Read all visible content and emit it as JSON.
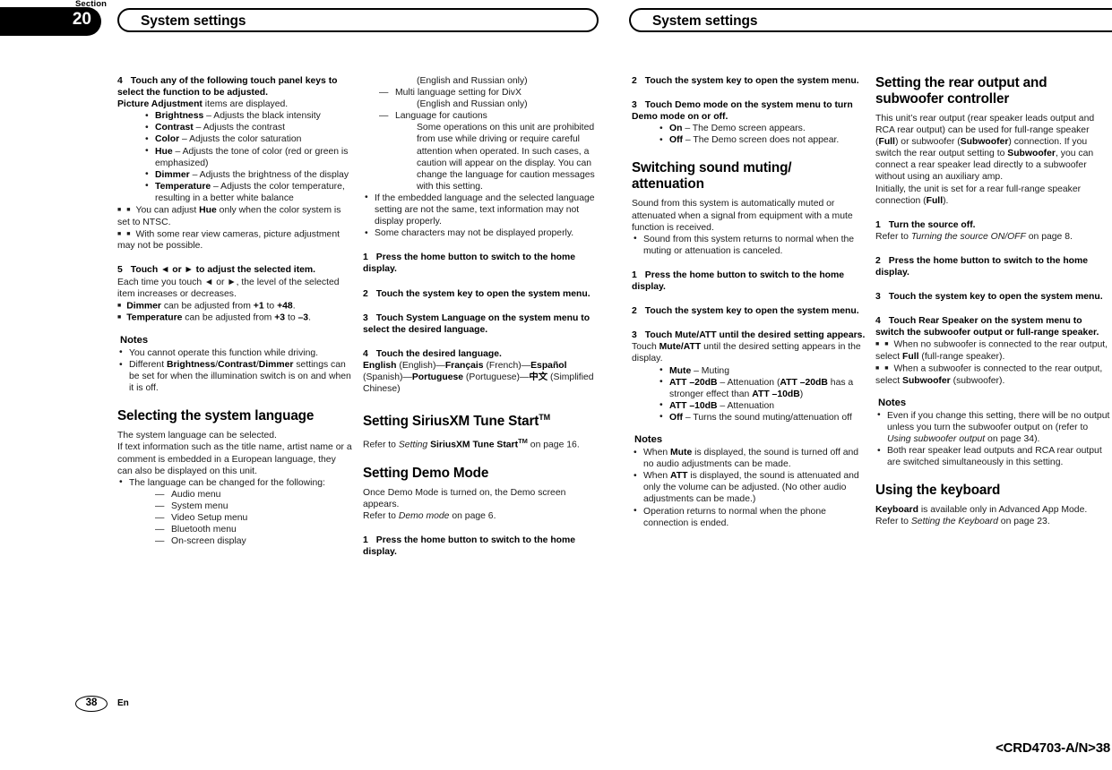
{
  "header": {
    "section_word": "Section",
    "section_number": "20",
    "title_left": "System settings",
    "title_right": "System settings"
  },
  "footer": {
    "page_number": "38",
    "language_code": "En",
    "doc_reference": "<CRD4703-A/N>38"
  },
  "col1": {
    "step4": {
      "number": "4",
      "text": "Touch any of the following touch panel keys to select the function to be adjusted."
    },
    "step4_intro_bold": "Picture Adjustment",
    "step4_intro_rest": " items are displayed.",
    "adjust_items": [
      {
        "term": "Brightness",
        "desc": " – Adjusts the black intensity"
      },
      {
        "term": "Contrast",
        "desc": " – Adjusts the contrast"
      },
      {
        "term": "Color",
        "desc": " – Adjusts the color saturation"
      },
      {
        "term": "Hue",
        "desc": " – Adjusts the tone of color (red or green is emphasized)"
      },
      {
        "term": "Dimmer",
        "desc": " – Adjusts the brightness of the display"
      },
      {
        "term": "Temperature",
        "desc": " – Adjusts the color temperature, resulting in a better white balance"
      }
    ],
    "note_hue_a": "You can adjust ",
    "note_hue_b": "Hue",
    "note_hue_c": " only when the color system is set to NTSC.",
    "note_camera": "With some rear view cameras, picture adjustment may not be possible.",
    "step5": {
      "number": "5",
      "text": "Touch ◄ or ► to adjust the selected item."
    },
    "step5_body": "Each time you touch ◄ or ►, the level of the selected item increases or decreases.",
    "range_dimmer": {
      "term": "Dimmer",
      "mid": " can be adjusted from ",
      "from": "+1",
      "to_word": " to ",
      "to": "+48",
      "end": "."
    },
    "range_temp": {
      "term": "Temperature",
      "mid": " can be adjusted from ",
      "from": "+3",
      "to_word": " to ",
      "to": "–3",
      "end": "."
    },
    "notes_label": "Notes",
    "note_driving": "You cannot operate this function while driving.",
    "note_diff_a": "Different ",
    "note_diff_b": "Brightness",
    "note_diff_c": "/",
    "note_diff_d": "Contrast",
    "note_diff_e": "/",
    "note_diff_f": "Dimmer",
    "note_diff_g": " settings can be set for when the illumination switch is on and when it is off.",
    "heading_language": "Selecting the system language",
    "lang_p1": "The system language can be selected.",
    "lang_p2": "If text information such as the title name, artist name or a comment is embedded in a European language, they can also be displayed on this unit.",
    "lang_bullet": "The language can be changed for the following:",
    "lang_menus": [
      "Audio menu",
      "System menu",
      "Video Setup menu",
      "Bluetooth menu",
      "On-screen display"
    ]
  },
  "col2": {
    "cont_note_1": "(English and Russian only)",
    "dash_divx": "Multi language setting for DivX",
    "cont_note_2": "(English and Russian only)",
    "dash_cautions": "Language for cautions",
    "cautions_body": "Some operations on this unit are prohibited from use while driving or require careful attention when operated. In such cases, a caution will appear on the display. You can change the language for caution messages with this setting.",
    "bullet_embedded": "If the embedded language and the selected language setting are not the same, text information may not display properly.",
    "bullet_chars": "Some characters may not be displayed properly.",
    "step1": {
      "number": "1",
      "text": "Press the home button to switch to the home display."
    },
    "step2": {
      "number": "2",
      "text": "Touch the system key to open the system menu."
    },
    "step3": {
      "number": "3",
      "text": "Touch System Language on the system menu to select the desired language."
    },
    "step4": {
      "number": "4",
      "text": "Touch the desired language."
    },
    "languages": [
      {
        "bold": "English",
        "plain": " (English)—"
      },
      {
        "bold": "Français",
        "plain": " (French)—"
      },
      {
        "bold": "Español",
        "plain": " (Spanish)—"
      },
      {
        "bold": "Portuguese",
        "plain": " (Portuguese)—"
      },
      {
        "bold": "中文",
        "plain": " (Simplified Chinese)"
      }
    ],
    "heading_tunestart_a": "Setting ",
    "heading_tunestart_b": "SiriusXM Tune Start",
    "heading_tunestart_tm": "TM",
    "tunestart_ref_a": "Refer to ",
    "tunestart_ref_italic": "Setting ",
    "tunestart_ref_bold": "SiriusXM Tune Start",
    "tunestart_ref_tm": "TM",
    "tunestart_ref_end": " on page 16.",
    "heading_demo": "Setting Demo Mode",
    "demo_p1": "Once Demo Mode is turned on, the Demo screen appears.",
    "demo_ref_a": "Refer to ",
    "demo_ref_italic": "Demo mode",
    "demo_ref_end": " on page 6.",
    "demo_step1": {
      "number": "1",
      "text": "Press the home button to switch to the home display."
    }
  },
  "col3": {
    "step2": {
      "number": "2",
      "text": "Touch the system key to open the system menu."
    },
    "step3": {
      "number": "3",
      "text": "Touch Demo mode on the system menu to turn Demo mode on or off."
    },
    "demo_options": [
      {
        "term": "On",
        "desc": " – The Demo screen appears."
      },
      {
        "term": "Off",
        "desc": " – The Demo screen does not appear."
      }
    ],
    "heading_muting": "Switching sound muting/ attenuation",
    "mute_p1": "Sound from this system is automatically muted or attenuated when a signal from equipment with a mute function is received.",
    "mute_bullet": "Sound from this system returns to normal when the muting or attenuation is canceled.",
    "mstep1": {
      "number": "1",
      "text": "Press the home button to switch to the home display."
    },
    "mstep2": {
      "number": "2",
      "text": "Touch the system key to open the system menu."
    },
    "mstep3": {
      "number": "3",
      "text": "Touch Mute/ATT until the desired setting appears."
    },
    "mstep3_body_a": "Touch ",
    "mstep3_body_b": "Mute/ATT",
    "mstep3_body_c": " until the desired setting appears in the display.",
    "mute_options": [
      {
        "term": "Mute",
        "desc": " – Muting"
      },
      {
        "term": "ATT –20dB",
        "desc": " – Attenuation (",
        "bold2": "ATT –20dB",
        "desc2": " has a stronger effect than ",
        "bold3": "ATT –10dB",
        "desc3": ")"
      },
      {
        "term": "ATT –10dB",
        "desc": " – Attenuation"
      },
      {
        "term": "Off",
        "desc": " – Turns the sound muting/attenuation off"
      }
    ],
    "notes_label": "Notes",
    "note1_a": "When ",
    "note1_b": "Mute",
    "note1_c": " is displayed, the sound is turned off and no audio adjustments can be made.",
    "note2_a": "When ",
    "note2_b": "ATT",
    "note2_c": " is displayed, the sound is attenuated and only the volume can be adjusted. (No other audio adjustments can be made.)",
    "note3": "Operation returns to normal when the phone connection is ended."
  },
  "col4": {
    "heading_rear": "Setting the rear output and subwoofer controller",
    "rear_p1_a": "This unit’s rear output (rear speaker leads output and RCA rear output) can be used for full-range speaker (",
    "rear_p1_b": "Full",
    "rear_p1_c": ") or subwoofer (",
    "rear_p1_d": "Subwoofer",
    "rear_p1_e": ") connection. If you switch the rear output setting to ",
    "rear_p1_f": "Subwoofer",
    "rear_p1_g": ", you can connect a rear speaker lead directly to a subwoofer without using an auxiliary amp.",
    "rear_p2_a": "Initially, the unit is set for a rear full-range speaker connection (",
    "rear_p2_b": "Full",
    "rear_p2_c": ").",
    "step1": {
      "number": "1",
      "text": "Turn the source off."
    },
    "step1_ref_a": "Refer to ",
    "step1_ref_italic": "Turning the source ON/OFF",
    "step1_ref_end": " on page 8.",
    "step2": {
      "number": "2",
      "text": "Press the home button to switch to the home display."
    },
    "step3": {
      "number": "3",
      "text": "Touch the system key to open the system menu."
    },
    "step4": {
      "number": "4",
      "text": "Touch Rear Speaker on the system menu to switch the subwoofer output or full-range speaker."
    },
    "sq1_a": "When no subwoofer is connected to the rear output, select ",
    "sq1_b": "Full",
    "sq1_c": " (full-range speaker).",
    "sq2_a": "When a subwoofer is connected to the rear output, select ",
    "sq2_b": "Subwoofer",
    "sq2_c": " (subwoofer).",
    "notes_label": "Notes",
    "note1_a": "Even if you change this setting, there will be no output unless you turn the subwoofer output on (refer to ",
    "note1_italic": "Using subwoofer output",
    "note1_b": " on page 34).",
    "note2": "Both rear speaker lead outputs and RCA rear output are switched simultaneously in this setting.",
    "heading_keyboard": "Using the keyboard",
    "kb_a": "Keyboard",
    "kb_b": " is available only in Advanced App Mode.",
    "kb_ref_a": "Refer to ",
    "kb_ref_italic": "Setting the Keyboard",
    "kb_ref_end": " on page 23."
  }
}
